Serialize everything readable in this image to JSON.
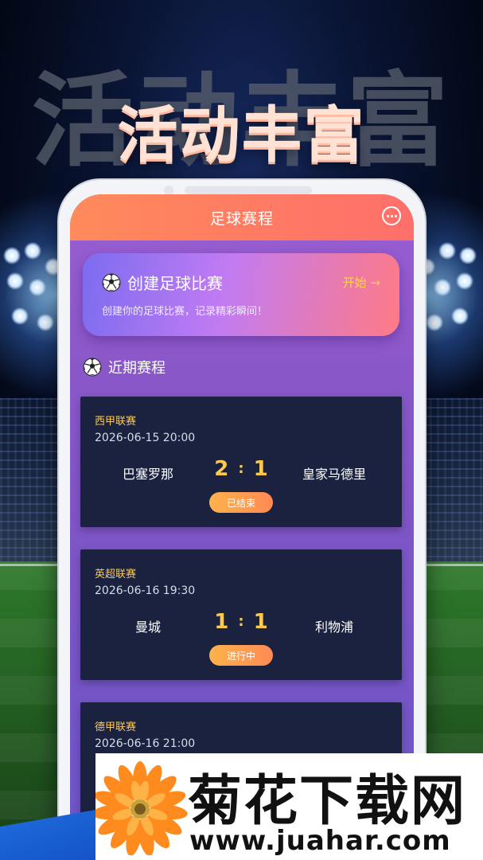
{
  "headline": "活动丰富",
  "app": {
    "title": "足球赛程",
    "more_icon": "more-dots-icon"
  },
  "create_card": {
    "title": "创建足球比赛",
    "action": "开始 →",
    "subtitle": "创建你的足球比赛，记录精彩瞬间！",
    "icon": "soccer-ball-icon"
  },
  "section": {
    "title": "近期赛程",
    "icon": "soccer-ball-icon"
  },
  "matches": [
    {
      "league": "西甲联赛",
      "datetime": "2026-06-15 20:00",
      "home": "巴塞罗那",
      "away": "皇家马德里",
      "home_score": "2",
      "away_score": "1",
      "separator": ":",
      "status": "已结束"
    },
    {
      "league": "英超联赛",
      "datetime": "2026-06-16 19:30",
      "home": "曼城",
      "away": "利物浦",
      "home_score": "1",
      "away_score": "1",
      "separator": ":",
      "status": "进行中"
    },
    {
      "league": "德甲联赛",
      "datetime": "2026-06-16 21:00"
    }
  ],
  "watermark": {
    "title": "菊花下载网",
    "url": "www.juahar.com"
  },
  "colors": {
    "appbar": "#ff7a62",
    "accent_gold": "#ffc94a",
    "card_dark": "#1a2240"
  }
}
